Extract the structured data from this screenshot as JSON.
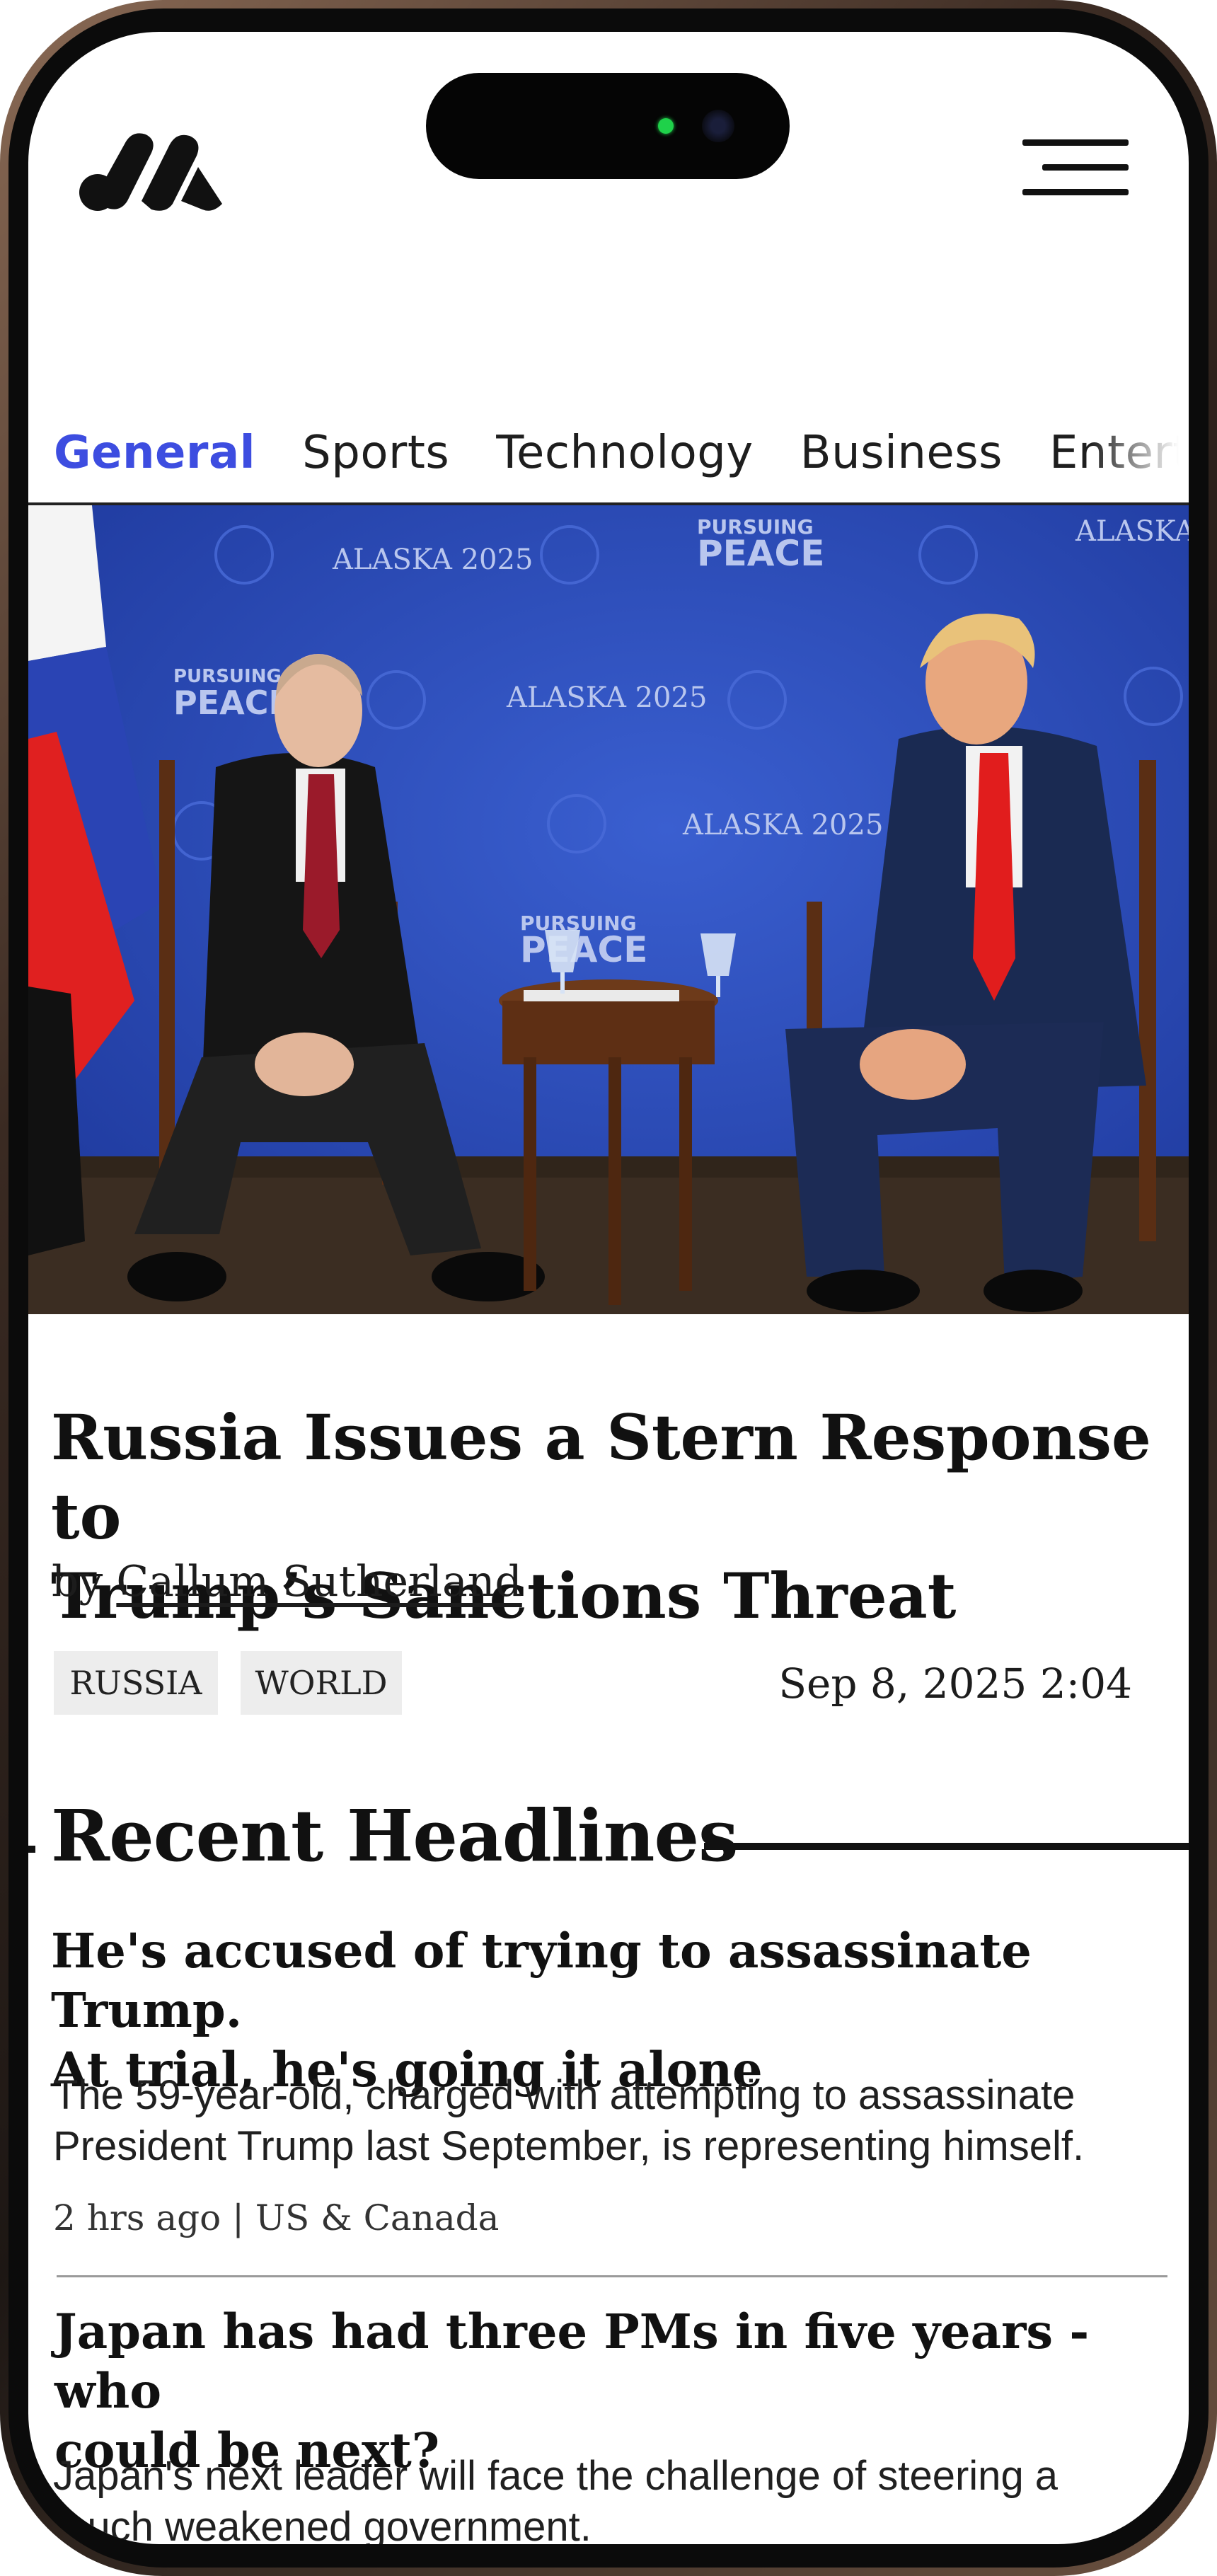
{
  "nav": {
    "tabs": [
      "General",
      "Sports",
      "Technology",
      "Business",
      "Entertainment"
    ],
    "active_tab": "General"
  },
  "hero": {
    "backdrop_texts": [
      "ALASKA 2025",
      "PURSUING",
      "PEACE"
    ]
  },
  "article": {
    "title_line1": "Russia Issues a Stern Response to",
    "title_line2": "Trump’s Sanctions Threat",
    "by_label": "by",
    "author": "Callum Sutherland",
    "tags": [
      "RUSSIA",
      "WORLD"
    ],
    "timestamp": "Sep 8, 2025 2:04"
  },
  "recent": {
    "heading": "Recent Headlines",
    "items": [
      {
        "title_line1": "He's accused of trying to assassinate Trump.",
        "title_line2": "At trial, he's going it alone",
        "summary_line1": "The 59-year-old, charged with attempting to assassinate",
        "summary_line2": "President Trump last September, is representing himself.",
        "meta": "2 hrs ago | US & Canada"
      },
      {
        "title_line1": "Japan has had three PMs in five years - who",
        "title_line2": "could be next?",
        "summary_line1": "Japan's next leader will face the challenge of steering a",
        "summary_line2": "much weakened government.",
        "meta": ""
      }
    ]
  },
  "colors": {
    "accent": "#3d4de0",
    "tag_bg": "#ededed",
    "hero_backdrop": "#2b49b8",
    "tie_red": "#e11d1d"
  },
  "icons": [
    "app-logo-icon",
    "hamburger-menu-icon",
    "camera-icon"
  ]
}
